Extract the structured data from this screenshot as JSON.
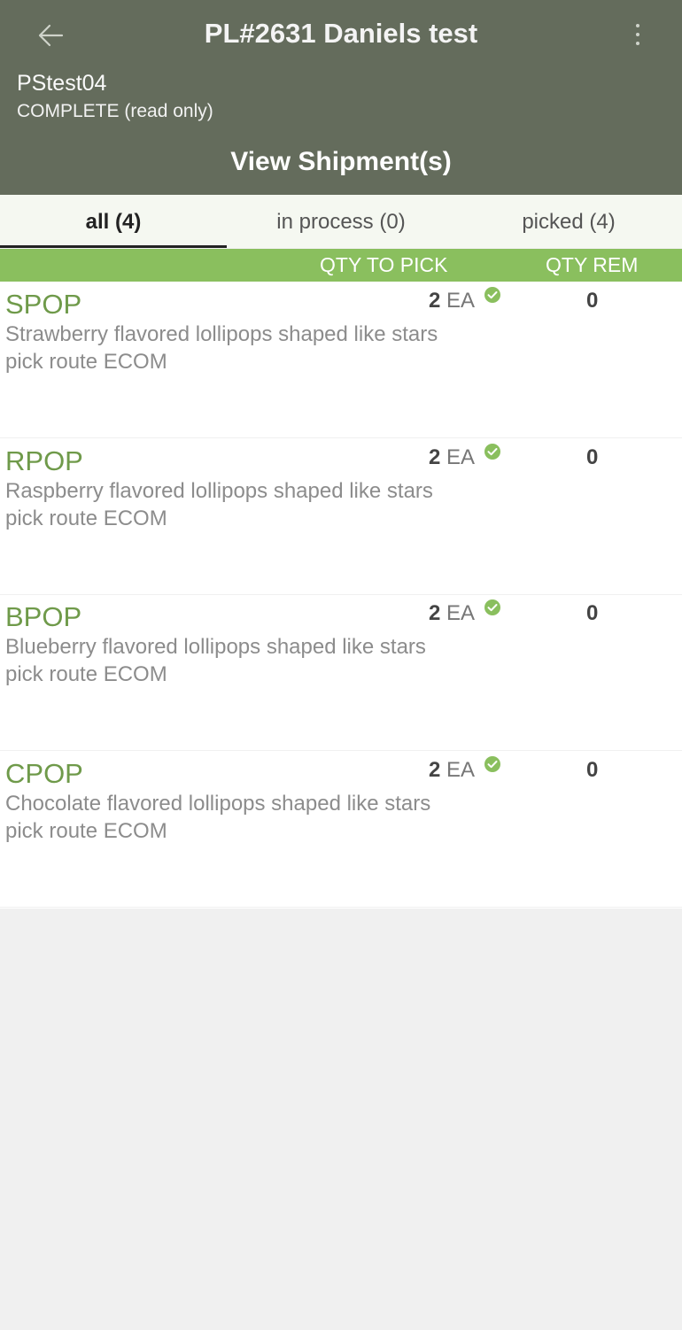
{
  "header": {
    "title": "PL#2631 Daniels test",
    "subtitle": "PStest04",
    "status": "COMPLETE (read only)",
    "view_shipments_label": "View Shipment(s)"
  },
  "tabs": [
    {
      "label": "all (4)",
      "active": true
    },
    {
      "label": "in process (0)",
      "active": false
    },
    {
      "label": "picked (4)",
      "active": false
    }
  ],
  "columns": {
    "qty_to_pick": "QTY TO PICK",
    "qty_rem": "QTY REM"
  },
  "items": [
    {
      "sku": "SPOP",
      "description": "Strawberry flavored lollipops shaped like stars",
      "route": "pick route ECOM",
      "qty": "2",
      "unit": "EA",
      "remaining": "0"
    },
    {
      "sku": "RPOP",
      "description": "Raspberry flavored lollipops shaped like stars",
      "route": "pick route ECOM",
      "qty": "2",
      "unit": "EA",
      "remaining": "0"
    },
    {
      "sku": "BPOP",
      "description": "Blueberry flavored lollipops shaped like stars",
      "route": "pick route ECOM",
      "qty": "2",
      "unit": "EA",
      "remaining": "0"
    },
    {
      "sku": "CPOP",
      "description": "Chocolate flavored lollipops shaped like stars",
      "route": "pick route ECOM",
      "qty": "2",
      "unit": "EA",
      "remaining": "0"
    }
  ],
  "colors": {
    "header_bg": "#646c5c",
    "accent_green": "#8abf5e",
    "sku_green": "#6f9a4a"
  },
  "icons": {
    "back": "arrow-left-icon",
    "menu": "kebab-menu-icon",
    "picked": "check-circle-icon"
  }
}
